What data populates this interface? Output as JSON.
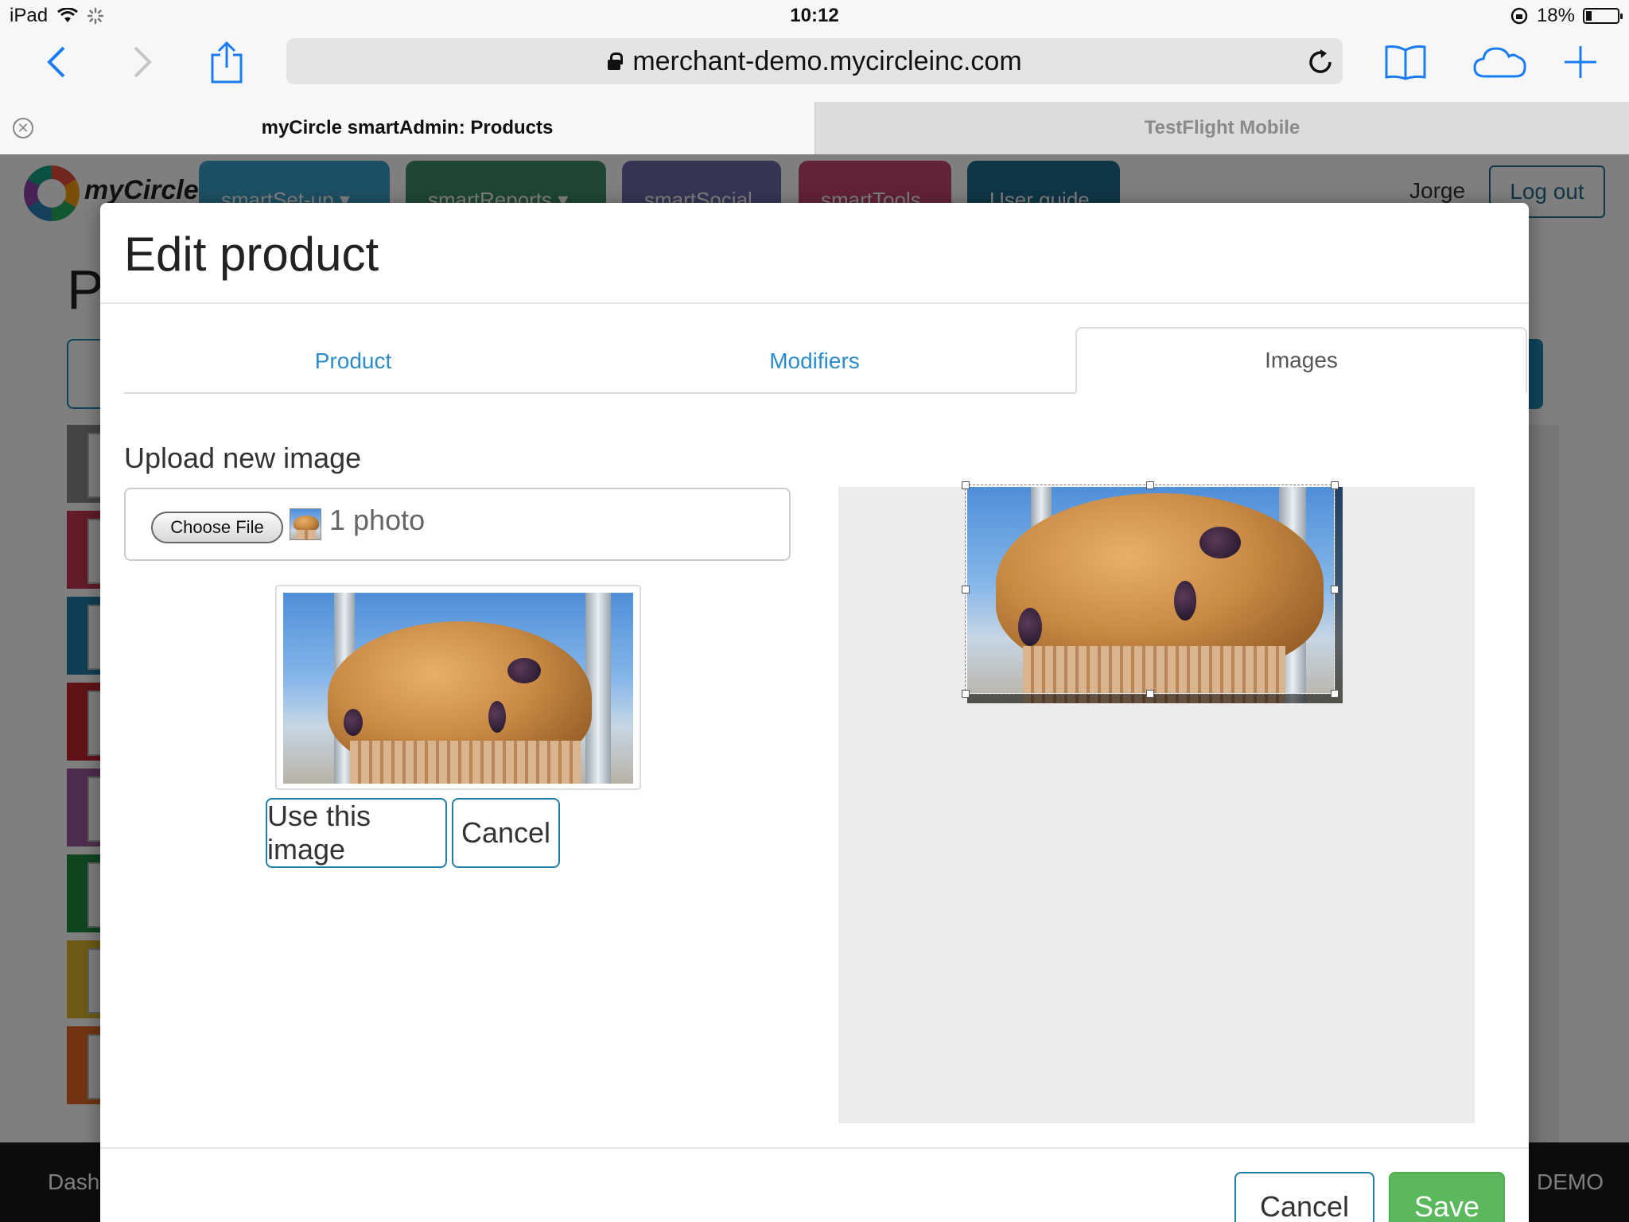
{
  "status_bar": {
    "device": "iPad",
    "time": "10:12",
    "battery": "18%",
    "battery_level": 0.18
  },
  "browser": {
    "url": "merchant-demo.mycircleinc.com",
    "tabs": [
      {
        "title": "myCircle smartAdmin: Products",
        "active": true
      },
      {
        "title": "TestFlight Mobile",
        "active": false
      }
    ],
    "icons": [
      "back-icon",
      "forward-icon",
      "share-icon",
      "reload-icon",
      "bookmarks-icon",
      "cloud-tabs-icon",
      "new-tab-icon"
    ]
  },
  "site": {
    "logo": "myCircle",
    "nav": [
      {
        "label": "smartSet-up ▾",
        "color": "#3aa0c8"
      },
      {
        "label": "smartReports ▾",
        "color": "#3f8f66"
      },
      {
        "label": "smartSocial",
        "color": "#6c6aa8"
      },
      {
        "label": "smartTools",
        "color": "#c4456e"
      },
      {
        "label": "User guide",
        "color": "#1f6c8c"
      }
    ],
    "user": "Jorge",
    "logout": "Log out",
    "page_title_partial": "P",
    "footer_left": "Dash",
    "footer_right": ": DEMO"
  },
  "modal": {
    "title": "Edit product",
    "tabs": [
      {
        "label": "Product",
        "active": false
      },
      {
        "label": "Modifiers",
        "active": false
      },
      {
        "label": "Images",
        "active": true
      }
    ],
    "upload_label": "Upload new image",
    "choose_file": "Choose File",
    "file_count": "1 photo",
    "use_image": "Use this image",
    "cancel_inline": "Cancel",
    "footer_cancel": "Cancel",
    "footer_save": "Save"
  },
  "colors": {
    "accent": "#1f7ea8",
    "tab_link": "#2b8ccc",
    "save": "#5cb85c",
    "ios_blue": "#1a7cf2"
  }
}
